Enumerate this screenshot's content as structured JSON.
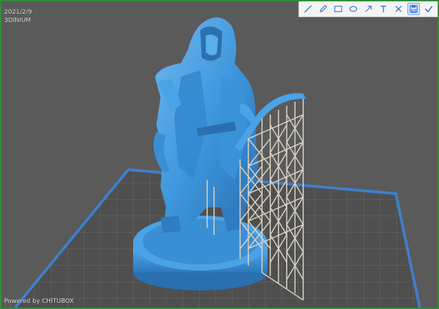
{
  "overlay": {
    "date": "2021/2/9",
    "brand": "3DINIUM",
    "footer": "Powered by CHITUBOX"
  },
  "toolbar": {
    "tools": [
      {
        "name": "line-icon",
        "active": false
      },
      {
        "name": "pen-icon",
        "active": false
      },
      {
        "name": "rectangle-icon",
        "active": false
      },
      {
        "name": "ellipse-icon",
        "active": false
      },
      {
        "name": "arrow-icon",
        "active": false
      },
      {
        "name": "text-icon",
        "active": false
      },
      {
        "name": "close-icon",
        "active": false
      },
      {
        "name": "save-icon",
        "active": true
      },
      {
        "name": "check-icon",
        "active": false
      }
    ]
  },
  "colors": {
    "model": "#4a9fe0",
    "model_dark": "#2b74b3",
    "supports": "#d8d2c4",
    "grid": "#6a6a6a",
    "plate_border": "#3f7fcc",
    "toolbar_icon": "#3a78c2"
  }
}
